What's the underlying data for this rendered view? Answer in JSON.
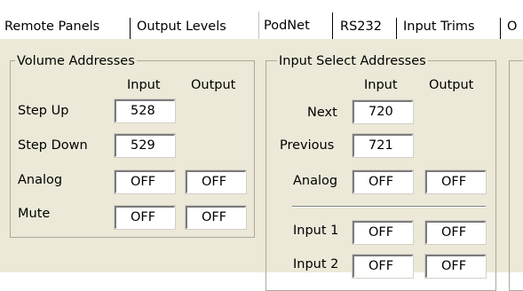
{
  "tabs": [
    {
      "label": "Remote Panels",
      "active": false
    },
    {
      "label": "Output Levels",
      "active": false
    },
    {
      "label": "PodNet",
      "active": true
    },
    {
      "label": "RS232",
      "active": false
    },
    {
      "label": "Input Trims",
      "active": false
    },
    {
      "label": "O",
      "active": false
    }
  ],
  "volume": {
    "title": "Volume Addresses",
    "col_input": "Input",
    "col_output": "Output",
    "step_up": {
      "label": "Step Up",
      "input": "528"
    },
    "step_down": {
      "label": "Step Down",
      "input": "529"
    },
    "analog": {
      "label": "Analog",
      "input": "OFF",
      "output": "OFF"
    },
    "mute": {
      "label": "Mute",
      "input": "OFF",
      "output": "OFF"
    }
  },
  "input_select": {
    "title": "Input Select Addresses",
    "col_input": "Input",
    "col_output": "Output",
    "next": {
      "label": "Next",
      "input": "720"
    },
    "previous": {
      "label": "Previous",
      "input": "721"
    },
    "analog": {
      "label": "Analog",
      "input": "OFF",
      "output": "OFF"
    },
    "input1": {
      "label": "Input 1",
      "input": "OFF",
      "output": "OFF"
    },
    "input2": {
      "label": "Input 2",
      "input": "OFF",
      "output": "OFF"
    }
  },
  "colors": {
    "panel_bg": "#ece9d8",
    "groupbox_border": "#aca899",
    "field_bg": "#ffffff"
  }
}
